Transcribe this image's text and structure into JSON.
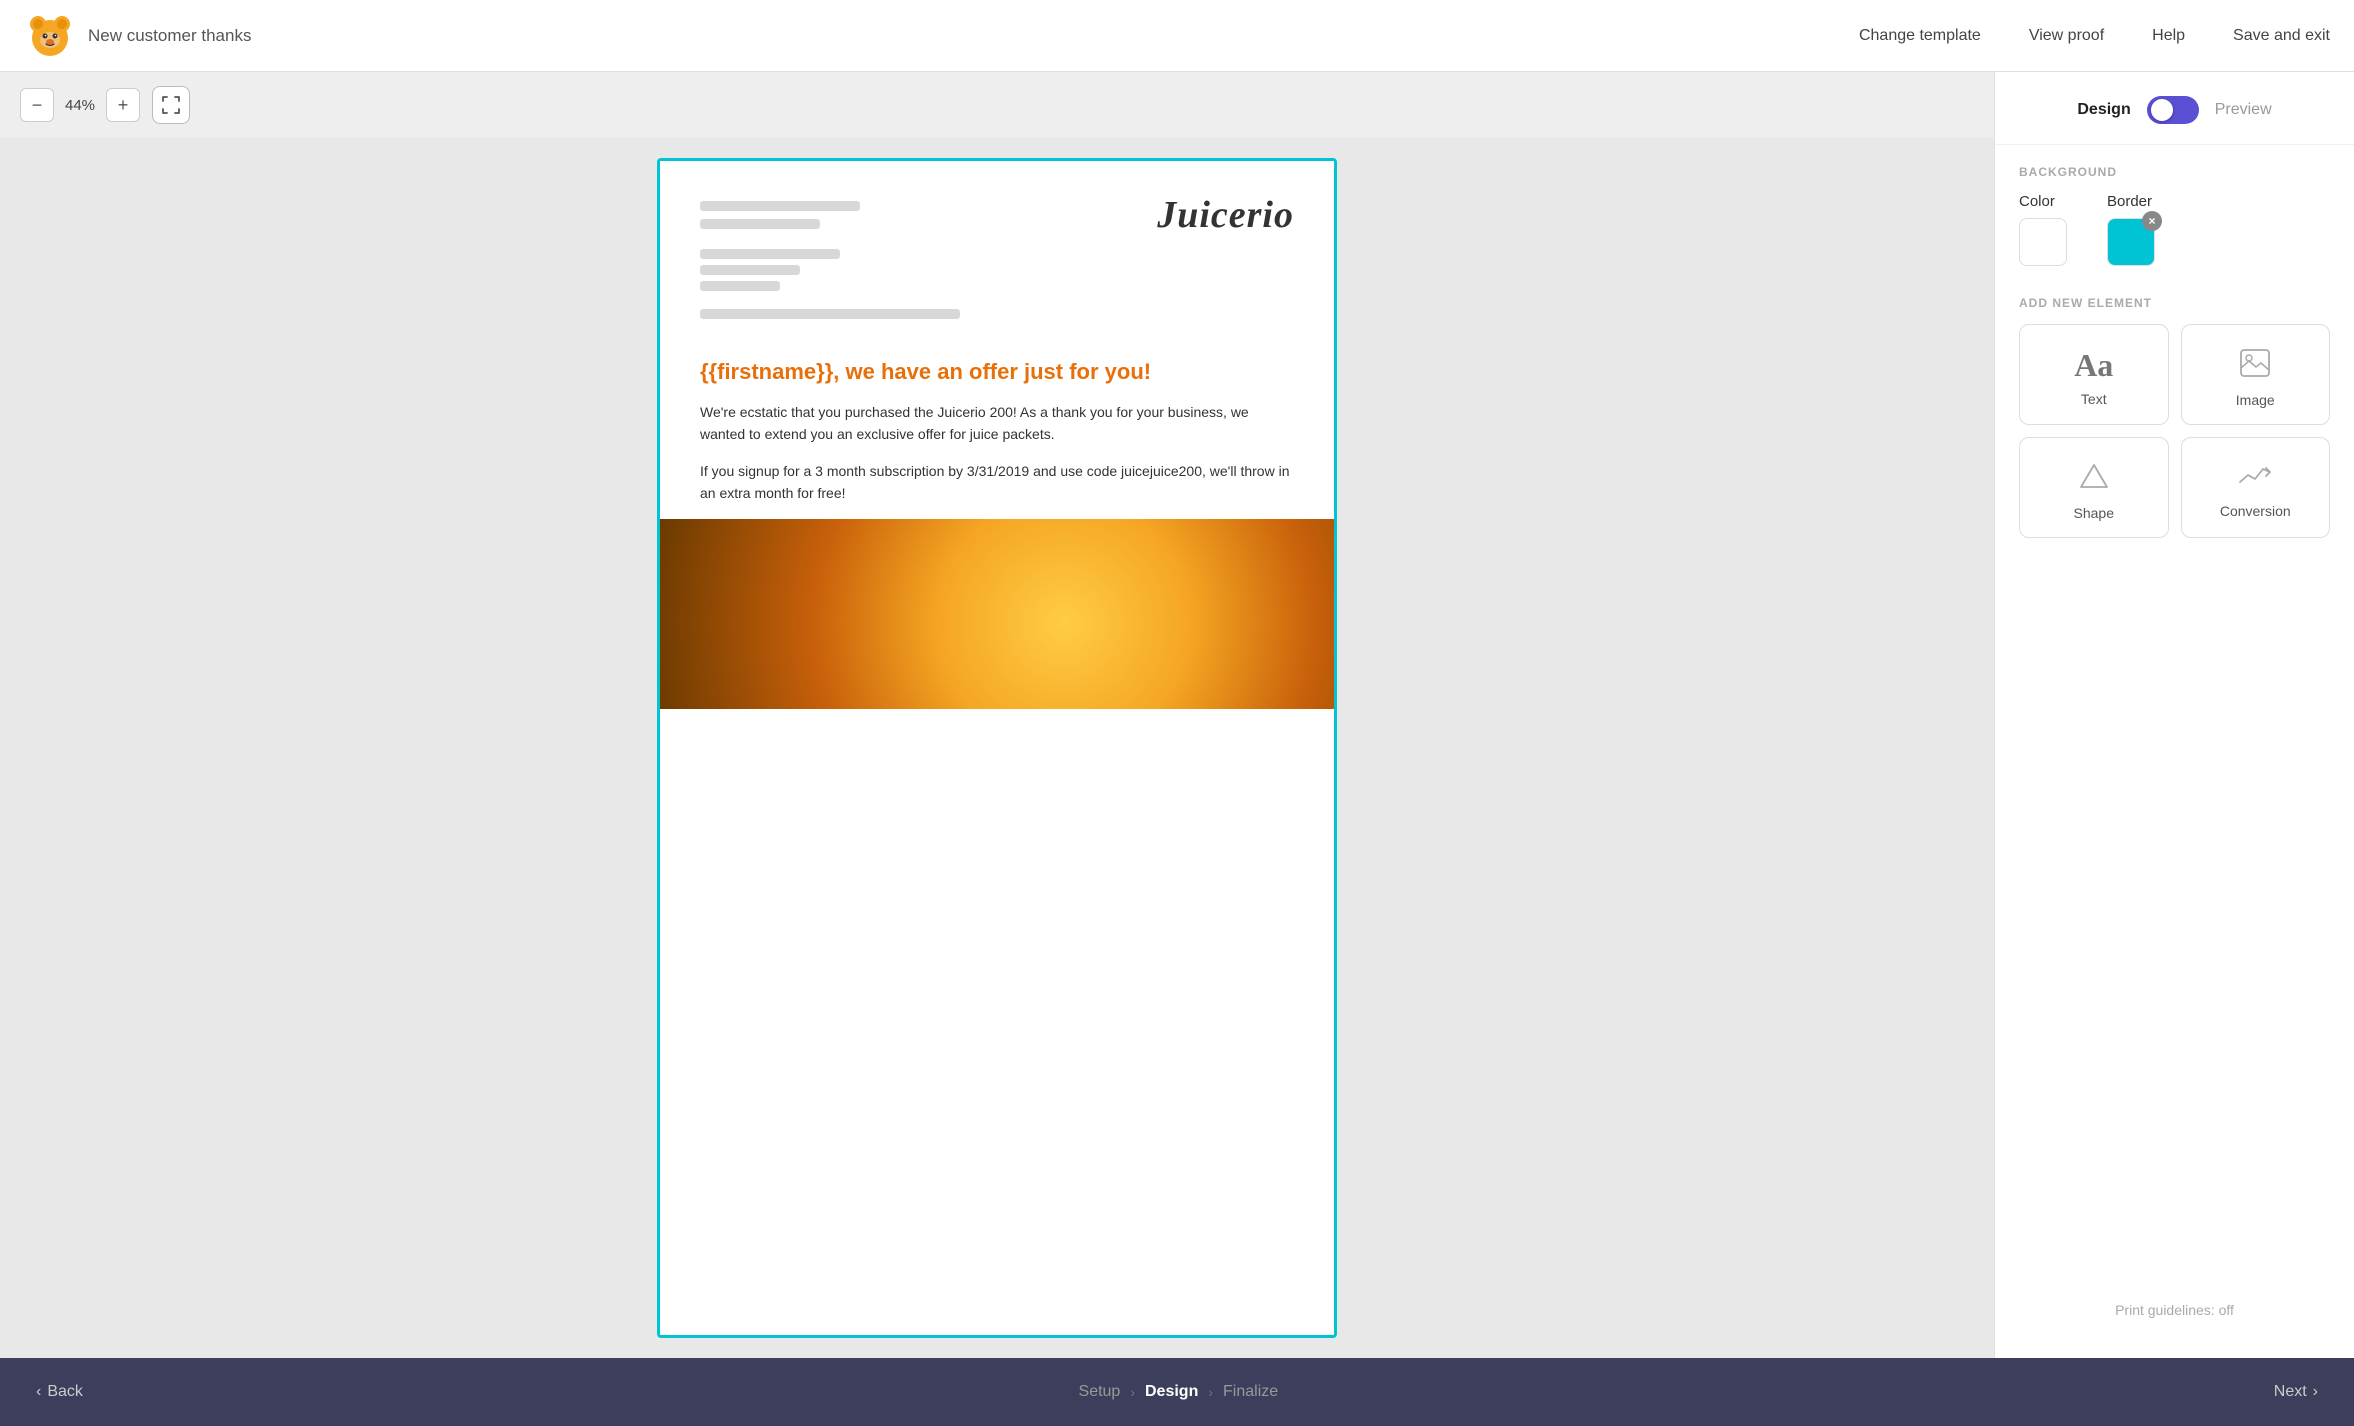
{
  "header": {
    "logo_alt": "Campfire bear logo",
    "doc_title": "New customer thanks",
    "nav": {
      "change_template": "Change template",
      "view_proof": "View proof",
      "help": "Help",
      "save_exit": "Save and exit"
    }
  },
  "canvas": {
    "zoom_minus": "−",
    "zoom_value": "44%",
    "zoom_plus": "+",
    "fullscreen_icon": "⤢"
  },
  "email": {
    "brand_name": "Juicerio",
    "offer_heading": "{{firstname}}, we have an offer just for you!",
    "body_paragraph_1": "We're ecstatic that you purchased the Juicerio 200! As a thank you for your business, we wanted to extend you an exclusive offer for juice packets.",
    "body_paragraph_2": "If you signup for a 3 month subscription by 3/31/2019 and use code juicejuice200, we'll throw in an extra month for free!"
  },
  "right_panel": {
    "design_label": "Design",
    "preview_label": "Preview",
    "background_section_title": "BACKGROUND",
    "color_label": "Color",
    "border_label": "Border",
    "add_element_section_title": "ADD NEW ELEMENT",
    "elements": [
      {
        "id": "text",
        "label": "Text",
        "icon": "Aa"
      },
      {
        "id": "image",
        "label": "Image",
        "icon": "🖼"
      },
      {
        "id": "shape",
        "label": "Shape",
        "icon": "△"
      },
      {
        "id": "conversion",
        "label": "Conversion",
        "icon": "📈"
      }
    ],
    "print_guidelines": "Print guidelines: off"
  },
  "bottom_bar": {
    "back_label": "Back",
    "step_setup": "Setup",
    "step_design": "Design",
    "step_finalize": "Finalize",
    "next_label": "Next"
  }
}
